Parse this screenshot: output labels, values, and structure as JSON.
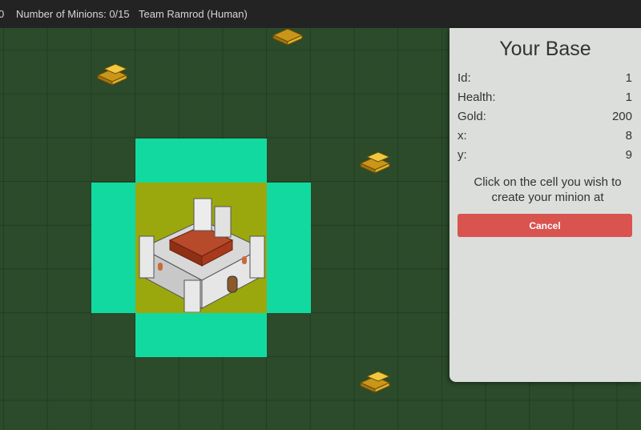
{
  "topbar": {
    "cut_text": "0",
    "minions": "Number of Minions: 0/15",
    "team": "Team Ramrod (Human)"
  },
  "panel": {
    "title": "Your Base",
    "stats": [
      {
        "label": "Id:",
        "value": "1"
      },
      {
        "label": "Health:",
        "value": "1"
      },
      {
        "label": "Gold:",
        "value": "200"
      },
      {
        "label": "x:",
        "value": "8"
      },
      {
        "label": "y:",
        "value": "9"
      }
    ],
    "message": "Click on the cell you wish to create your minion at",
    "cancel_label": "Cancel"
  },
  "colors": {
    "grass": "#2b4b2b",
    "highlight": "#12d9a0",
    "base_cell": "#9aa80e",
    "cancel": "#d9534f"
  },
  "icons": [
    "gold-bars-icon",
    "castle-icon"
  ]
}
